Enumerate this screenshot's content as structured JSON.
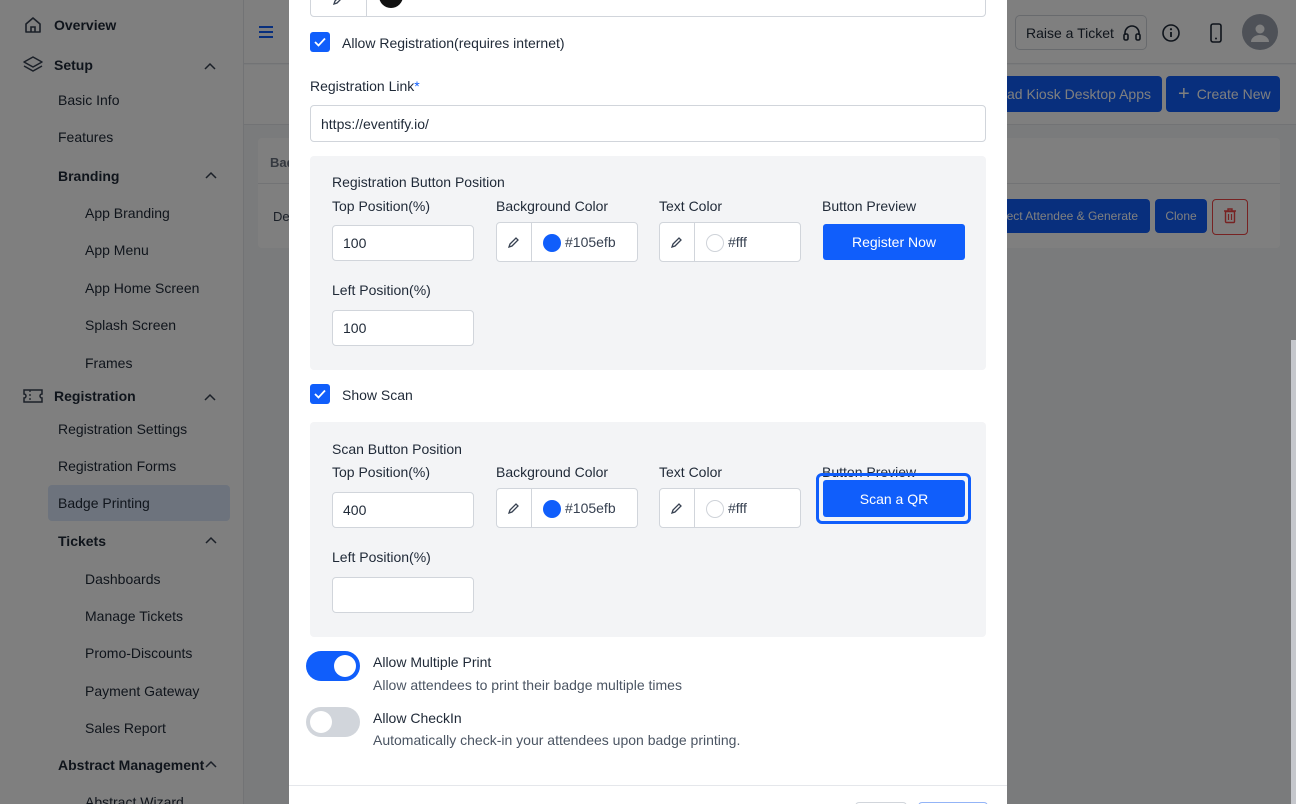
{
  "sidebar": {
    "overview": "Overview",
    "setup": "Setup",
    "basic_info": "Basic Info",
    "features": "Features",
    "branding": "Branding",
    "app_branding": "App Branding",
    "app_menu": "App Menu",
    "app_home_screen": "App Home Screen",
    "splash_screen": "Splash Screen",
    "frames": "Frames",
    "registration": "Registration",
    "registration_settings": "Registration Settings",
    "registration_forms": "Registration Forms",
    "badge_printing": "Badge Printing",
    "tickets": "Tickets",
    "dashboards": "Dashboards",
    "manage_tickets": "Manage Tickets",
    "promo_discounts": "Promo-Discounts",
    "payment_gateway": "Payment Gateway",
    "sales_report": "Sales Report",
    "abstract_management": "Abstract Management",
    "abstract_wizard": "Abstract Wizard"
  },
  "header": {
    "raise_ticket": "Raise a Ticket",
    "download_kiosk": "oad Kiosk Desktop Apps",
    "create_new": "Create New"
  },
  "background_card": {
    "head_text": "Bad",
    "row_text": "De",
    "generate_btn": "elect Attendee & Generate",
    "clone_btn": "Clone"
  },
  "modal": {
    "top_color_value": "#000000",
    "allow_registration_label": "Allow Registration(requires internet)",
    "registration_link_label": "Registration Link",
    "required_mark": "*",
    "registration_link_value": "https://eventify.io/",
    "registration_panel": {
      "title": "Registration Button Position",
      "top_label": "Top Position(%)",
      "top_value": "100",
      "bg_label": "Background Color",
      "bg_value": "#105efb",
      "text_label": "Text Color",
      "text_value": "#fff",
      "preview_label": "Button Preview",
      "preview_button": "Register Now",
      "left_label": "Left Position(%)",
      "left_value": "100"
    },
    "show_scan_label": "Show Scan",
    "scan_panel": {
      "title": "Scan Button Position",
      "top_label": "Top Position(%)",
      "top_value": "400",
      "bg_label": "Background Color",
      "bg_value": "#105efb",
      "text_label": "Text Color",
      "text_value": "#fff",
      "preview_label": "Button Preview",
      "preview_button": "Scan a QR",
      "left_label": "Left Position(%)",
      "left_value": ""
    },
    "allow_multiple_print": {
      "title": "Allow Multiple Print",
      "desc": "Allow attendees to print their badge multiple times",
      "on": true
    },
    "allow_checkin": {
      "title": "Allow CheckIn",
      "desc": "Automatically check-in your attendees upon badge printing.",
      "on": false
    }
  },
  "colors": {
    "accent": "#105efb",
    "overlay": "rgba(0,0,0,0.5)",
    "toggle_off": "#d1d5db"
  },
  "icons": {
    "overview": "home-icon",
    "setup": "layers-icon",
    "registration": "ticket-icon",
    "picker": "eyedropper-icon",
    "headset": "headset-icon",
    "info": "info-icon",
    "mobile": "mobile-icon",
    "trash": "trash-icon"
  }
}
